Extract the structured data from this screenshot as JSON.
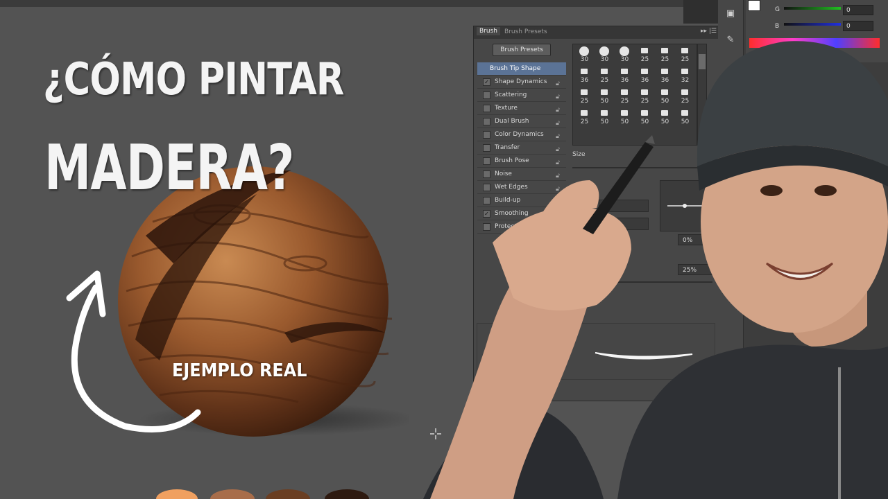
{
  "title": {
    "line1": "¿CÓMO PINTAR",
    "line2": "MADERA?",
    "caption": "EJEMPLO REAL"
  },
  "brush_panel": {
    "tabs": [
      "Brush",
      "Brush Presets"
    ],
    "menu_glyph": "▸▸ |☰",
    "presets_button": "Brush Presets",
    "options": [
      {
        "label": "Brush Tip Shape",
        "checked": null,
        "selected": true
      },
      {
        "label": "Shape Dynamics",
        "checked": true
      },
      {
        "label": "Scattering",
        "checked": false
      },
      {
        "label": "Texture",
        "checked": false
      },
      {
        "label": "Dual Brush",
        "checked": false
      },
      {
        "label": "Color Dynamics",
        "checked": false
      },
      {
        "label": "Transfer",
        "checked": false
      },
      {
        "label": "Brush Pose",
        "checked": false
      },
      {
        "label": "Noise",
        "checked": false
      },
      {
        "label": "Wet Edges",
        "checked": false
      },
      {
        "label": "Build-up",
        "checked": false
      },
      {
        "label": "Smoothing",
        "checked": true
      },
      {
        "label": "Protect T",
        "checked": false
      }
    ],
    "tip_sizes": [
      [
        30,
        30,
        30,
        25,
        25,
        25
      ],
      [
        36,
        25,
        36,
        36,
        36,
        32
      ],
      [
        25,
        50,
        25,
        25,
        50,
        25
      ],
      [
        25,
        50,
        50,
        50,
        50,
        50
      ]
    ],
    "size_label": "Size",
    "roundness_value": "0%",
    "spacing_value": "25%"
  },
  "color_panel": {
    "channels": [
      {
        "label": "G",
        "value": "0",
        "color": "#20c020"
      },
      {
        "label": "B",
        "value": "0",
        "color": "#2030e0"
      }
    ],
    "first_value": "0"
  },
  "colors": {
    "background": "#535353",
    "panel": "#474747",
    "selected_row": "#5b7396",
    "wood_dark": "#5a2e16",
    "wood_light": "#b06a3b"
  },
  "icons": [
    "cursor-crosshair-icon",
    "lock-icon",
    "checkmark-icon",
    "arrow-curve-icon"
  ]
}
